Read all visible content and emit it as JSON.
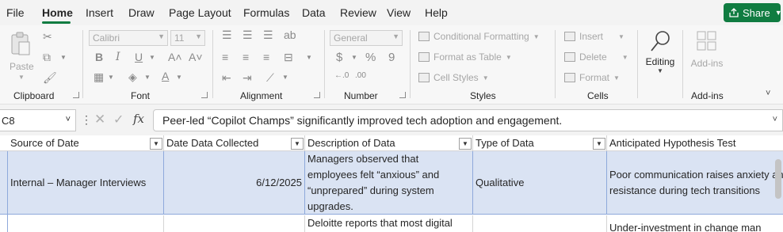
{
  "menu": {
    "tabs": [
      "File",
      "Home",
      "Insert",
      "Draw",
      "Page Layout",
      "Formulas",
      "Data",
      "Review",
      "View",
      "Help"
    ],
    "active": "Home",
    "share_label": "Share"
  },
  "ribbon": {
    "clipboard": {
      "label": "Clipboard",
      "paste_label": "Paste"
    },
    "font": {
      "label": "Font",
      "font_name": "Calibri",
      "font_size": "11"
    },
    "alignment": {
      "label": "Alignment"
    },
    "number": {
      "label": "Number",
      "format": "General",
      "dollar": "$",
      "percent": "%",
      "comma": "9"
    },
    "styles": {
      "label": "Styles",
      "conditional_formatting": "Conditional Formatting",
      "format_as_table": "Format as Table",
      "cell_styles": "Cell Styles"
    },
    "cells": {
      "label": "Cells",
      "insert": "Insert",
      "delete": "Delete",
      "format": "Format"
    },
    "editing": {
      "label": "Editing"
    },
    "addins": {
      "label": "Add-ins",
      "button": "Add-ins"
    }
  },
  "formula_bar": {
    "name_box": "C8",
    "fx": "fx",
    "content": "Peer-led “Copilot Champs” significantly improved tech adoption and engagement."
  },
  "sheet": {
    "headers": [
      "Source of Date",
      "Date Data Collected",
      "Description of Data",
      "Type of Data",
      "Anticipated Hypothesis Test"
    ],
    "row1": {
      "source": "Internal – Manager Interviews",
      "date": "6/12/2025",
      "description": "Managers observed that employees felt “anxious” and “unprepared” during system upgrades.",
      "type": "Qualitative",
      "hypothesis": "Poor communication raises anxiety and resistance during tech transitions"
    },
    "row2": {
      "description": "Deloitte reports that most digital",
      "hypothesis": "Under-investment in change man"
    }
  },
  "colors": {
    "accent": "#107c41",
    "row_fill": "#dae3f3",
    "row_border": "#8ea9db"
  }
}
